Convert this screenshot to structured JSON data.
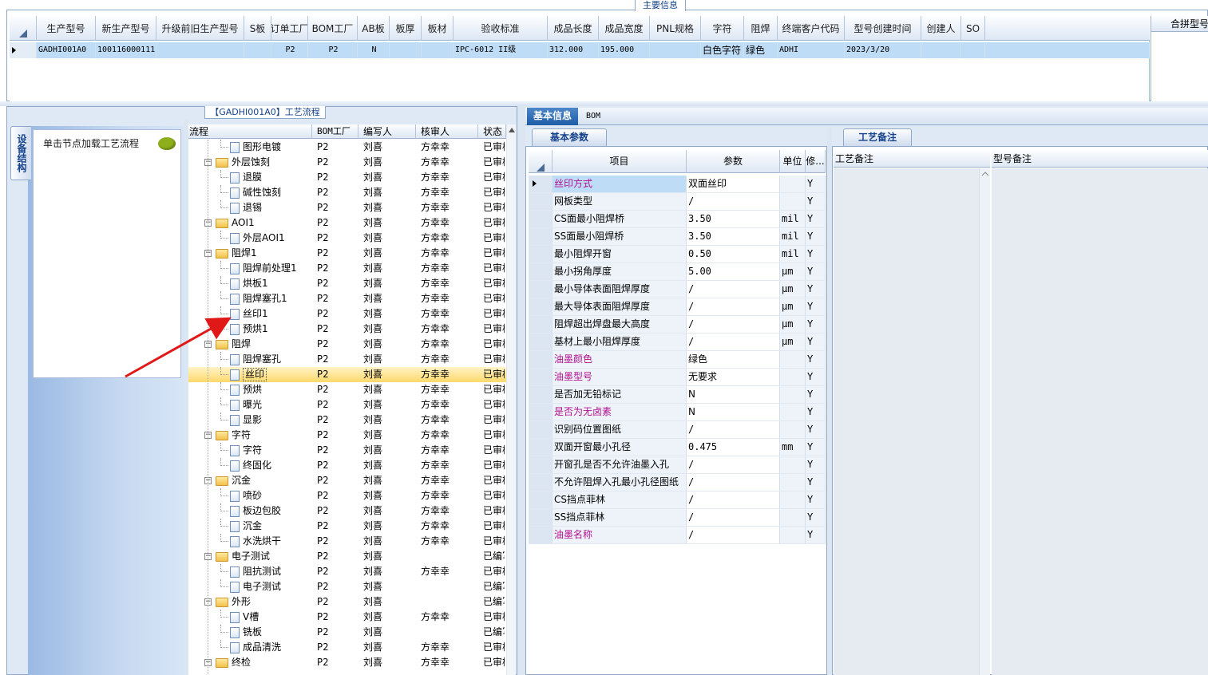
{
  "top": {
    "legend": "主要信息",
    "columns": [
      "生产型号",
      "新生产型号",
      "升级前旧生产型号",
      "S板",
      "订单工厂",
      "BOM工厂",
      "AB板",
      "板厚",
      "板材",
      "验收标准",
      "成品长度",
      "成品宽度",
      "PNL规格",
      "字符",
      "阻焊",
      "终端客户代码",
      "型号创建时间",
      "创建人",
      "SO"
    ],
    "row": [
      "GADHI001A0",
      "10011600011123",
      "",
      "",
      "P2",
      "P2",
      "N",
      "",
      "",
      "IPC-6012 II级",
      "312.000",
      "195.000",
      "",
      "白色字符",
      "绿色",
      "ADHI",
      "2023/3/20",
      "",
      ""
    ],
    "merge_header": "合拼型号"
  },
  "left": {
    "panel_title": "【GADHI001A0】工艺流程",
    "vtab": "设备结构",
    "hint": "单击节点加载工艺流程",
    "tree_columns": [
      "流程",
      "BOM工厂",
      "编写人",
      "核审人",
      "状态"
    ],
    "rows": [
      {
        "name": "图形电镀",
        "level": 2,
        "bom": "P2",
        "writer": "刘喜",
        "reviewer": "方幸幸",
        "status": "已审核"
      },
      {
        "name": "外层蚀刻",
        "level": 1,
        "bom": "P2",
        "writer": "刘喜",
        "reviewer": "方幸幸",
        "status": "已审核"
      },
      {
        "name": "退膜",
        "level": 2,
        "bom": "P2",
        "writer": "刘喜",
        "reviewer": "方幸幸",
        "status": "已审核"
      },
      {
        "name": "碱性蚀刻",
        "level": 2,
        "bom": "P2",
        "writer": "刘喜",
        "reviewer": "方幸幸",
        "status": "已审核"
      },
      {
        "name": "退锡",
        "level": 2,
        "bom": "P2",
        "writer": "刘喜",
        "reviewer": "方幸幸",
        "status": "已审核"
      },
      {
        "name": "AOI1",
        "level": 1,
        "bom": "P2",
        "writer": "刘喜",
        "reviewer": "方幸幸",
        "status": "已审核"
      },
      {
        "name": "外层AOI1",
        "level": 2,
        "bom": "P2",
        "writer": "刘喜",
        "reviewer": "方幸幸",
        "status": "已审核"
      },
      {
        "name": "阻焊1",
        "level": 1,
        "bom": "P2",
        "writer": "刘喜",
        "reviewer": "方幸幸",
        "status": "已审核"
      },
      {
        "name": "阻焊前处理1",
        "level": 2,
        "bom": "P2",
        "writer": "刘喜",
        "reviewer": "方幸幸",
        "status": "已审核"
      },
      {
        "name": "烘板1",
        "level": 2,
        "bom": "P2",
        "writer": "刘喜",
        "reviewer": "方幸幸",
        "status": "已审核"
      },
      {
        "name": "阻焊塞孔1",
        "level": 2,
        "bom": "P2",
        "writer": "刘喜",
        "reviewer": "方幸幸",
        "status": "已审核"
      },
      {
        "name": "丝印1",
        "level": 2,
        "bom": "P2",
        "writer": "刘喜",
        "reviewer": "方幸幸",
        "status": "已审核"
      },
      {
        "name": "预烘1",
        "level": 2,
        "bom": "P2",
        "writer": "刘喜",
        "reviewer": "方幸幸",
        "status": "已审核"
      },
      {
        "name": "阻焊",
        "level": 1,
        "bom": "P2",
        "writer": "刘喜",
        "reviewer": "方幸幸",
        "status": "已审核"
      },
      {
        "name": "阻焊塞孔",
        "level": 2,
        "bom": "P2",
        "writer": "刘喜",
        "reviewer": "方幸幸",
        "status": "已审核"
      },
      {
        "name": "丝印",
        "level": 2,
        "bom": "P2",
        "writer": "刘喜",
        "reviewer": "方幸幸",
        "status": "已审核",
        "selected": true
      },
      {
        "name": "预烘",
        "level": 2,
        "bom": "P2",
        "writer": "刘喜",
        "reviewer": "方幸幸",
        "status": "已审核"
      },
      {
        "name": "曝光",
        "level": 2,
        "bom": "P2",
        "writer": "刘喜",
        "reviewer": "方幸幸",
        "status": "已审核"
      },
      {
        "name": "显影",
        "level": 2,
        "bom": "P2",
        "writer": "刘喜",
        "reviewer": "方幸幸",
        "status": "已审核"
      },
      {
        "name": "字符",
        "level": 1,
        "bom": "P2",
        "writer": "刘喜",
        "reviewer": "方幸幸",
        "status": "已审核"
      },
      {
        "name": "字符",
        "level": 2,
        "bom": "P2",
        "writer": "刘喜",
        "reviewer": "方幸幸",
        "status": "已审核"
      },
      {
        "name": "终固化",
        "level": 2,
        "bom": "P2",
        "writer": "刘喜",
        "reviewer": "方幸幸",
        "status": "已审核"
      },
      {
        "name": "沉金",
        "level": 1,
        "bom": "P2",
        "writer": "刘喜",
        "reviewer": "方幸幸",
        "status": "已审核"
      },
      {
        "name": "喷砂",
        "level": 2,
        "bom": "P2",
        "writer": "刘喜",
        "reviewer": "方幸幸",
        "status": "已审核"
      },
      {
        "name": "板边包胶",
        "level": 2,
        "bom": "P2",
        "writer": "刘喜",
        "reviewer": "方幸幸",
        "status": "已审核"
      },
      {
        "name": "沉金",
        "level": 2,
        "bom": "P2",
        "writer": "刘喜",
        "reviewer": "方幸幸",
        "status": "已审核"
      },
      {
        "name": "水洗烘干",
        "level": 2,
        "bom": "P2",
        "writer": "刘喜",
        "reviewer": "方幸幸",
        "status": "已审核"
      },
      {
        "name": "电子测试",
        "level": 1,
        "bom": "P2",
        "writer": "刘喜",
        "reviewer": "",
        "status": "已编写"
      },
      {
        "name": "阻抗测试",
        "level": 2,
        "bom": "P2",
        "writer": "刘喜",
        "reviewer": "方幸幸",
        "status": "已审核"
      },
      {
        "name": "电子测试",
        "level": 2,
        "bom": "P2",
        "writer": "刘喜",
        "reviewer": "",
        "status": "已编写"
      },
      {
        "name": "外形",
        "level": 1,
        "bom": "P2",
        "writer": "刘喜",
        "reviewer": "",
        "status": "已编写"
      },
      {
        "name": "V槽",
        "level": 2,
        "bom": "P2",
        "writer": "刘喜",
        "reviewer": "方幸幸",
        "status": "已审核"
      },
      {
        "name": "铣板",
        "level": 2,
        "bom": "P2",
        "writer": "刘喜",
        "reviewer": "",
        "status": "已编写"
      },
      {
        "name": "成品清洗",
        "level": 2,
        "bom": "P2",
        "writer": "刘喜",
        "reviewer": "方幸幸",
        "status": "已审核"
      },
      {
        "name": "终检",
        "level": 1,
        "bom": "P2",
        "writer": "刘喜",
        "reviewer": "方幸幸",
        "status": "已审核"
      }
    ]
  },
  "right": {
    "tabs": [
      "基本信息",
      "BOM"
    ],
    "params_tab": "基本参数",
    "param_columns": [
      "项目",
      "参数",
      "单位",
      "修..."
    ],
    "params": [
      {
        "item": "丝印方式",
        "value": "双面丝印",
        "unit": "",
        "mod": "Y",
        "hl": true,
        "current": true
      },
      {
        "item": "网板类型",
        "value": "/",
        "unit": "",
        "mod": "Y"
      },
      {
        "item": "CS面最小阻焊桥",
        "value": "3.50",
        "unit": "mil",
        "mod": "Y"
      },
      {
        "item": "SS面最小阻焊桥",
        "value": "3.50",
        "unit": "mil",
        "mod": "Y"
      },
      {
        "item": "最小阻焊开窗",
        "value": "0.50",
        "unit": "mil",
        "mod": "Y"
      },
      {
        "item": "最小拐角厚度",
        "value": "5.00",
        "unit": "μm",
        "mod": "Y"
      },
      {
        "item": "最小导体表面阻焊厚度",
        "value": "/",
        "unit": "μm",
        "mod": "Y"
      },
      {
        "item": "最大导体表面阻焊厚度",
        "value": "/",
        "unit": "μm",
        "mod": "Y"
      },
      {
        "item": "阻焊超出焊盘最大高度",
        "value": "/",
        "unit": "μm",
        "mod": "Y"
      },
      {
        "item": "基材上最小阻焊厚度",
        "value": "/",
        "unit": "μm",
        "mod": "Y"
      },
      {
        "item": "油墨颜色",
        "value": "绿色",
        "unit": "",
        "mod": "Y",
        "hl": true
      },
      {
        "item": "油墨型号",
        "value": "无要求",
        "unit": "",
        "mod": "Y",
        "hl": true
      },
      {
        "item": "是否加无铅标记",
        "value": "N",
        "unit": "",
        "mod": "Y"
      },
      {
        "item": "是否为无卤素",
        "value": "N",
        "unit": "",
        "mod": "Y",
        "hl": true
      },
      {
        "item": "识别码位置图纸",
        "value": "/",
        "unit": "",
        "mod": "Y"
      },
      {
        "item": "双面开窗最小孔径",
        "value": "0.475",
        "unit": "mm",
        "mod": "Y"
      },
      {
        "item": "开窗孔是否不允许油墨入孔",
        "value": "/",
        "unit": "",
        "mod": "Y"
      },
      {
        "item": "不允许阻焊入孔最小孔径图纸",
        "value": "/",
        "unit": "",
        "mod": "Y"
      },
      {
        "item": "CS挡点菲林",
        "value": "/",
        "unit": "",
        "mod": "Y"
      },
      {
        "item": "SS挡点菲林",
        "value": "/",
        "unit": "",
        "mod": "Y"
      },
      {
        "item": "油墨名称",
        "value": "/",
        "unit": "",
        "mod": "Y",
        "hl": true
      }
    ],
    "notes_tab": "工艺备注",
    "notes_columns": [
      "工艺备注",
      "型号备注"
    ]
  },
  "colors": {
    "accent": "#1d5ca7",
    "highlight_text": "#b0108e",
    "selection": "#bfdcf6",
    "tree_selection": "#ffd96b",
    "arrow": "#e01818"
  }
}
